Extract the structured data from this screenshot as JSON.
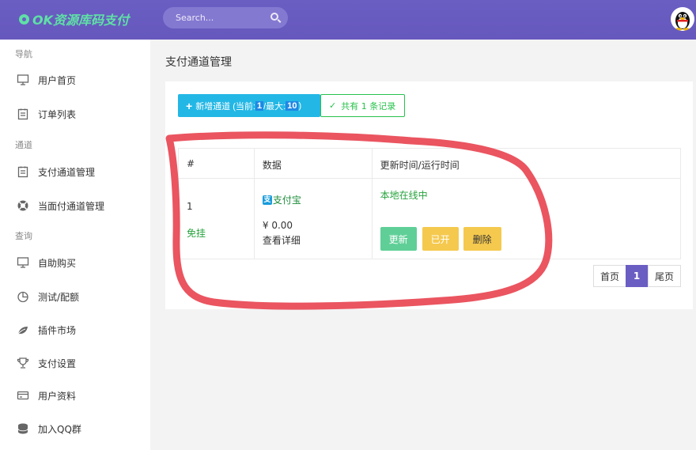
{
  "header": {
    "brand": "OK资源库码支付",
    "search_placeholder": "Search..."
  },
  "sidebar": {
    "sections": [
      "导航",
      "通道",
      "查询"
    ],
    "items": [
      {
        "label": "用户首页",
        "icon": "monitor-icon"
      },
      {
        "label": "订单列表",
        "icon": "clipboard-icon"
      },
      {
        "label": "支付通道管理",
        "icon": "clipboard-icon"
      },
      {
        "label": "当面付通道管理",
        "icon": "lifebuoy-icon"
      },
      {
        "label": "自助购买",
        "icon": "monitor-icon"
      },
      {
        "label": "测试/配额",
        "icon": "pie-chart-icon"
      },
      {
        "label": "插件市场",
        "icon": "leaf-icon"
      },
      {
        "label": "支付设置",
        "icon": "trophy-icon"
      },
      {
        "label": "用户资料",
        "icon": "credit-card-icon"
      },
      {
        "label": "加入QQ群",
        "icon": "database-icon"
      }
    ]
  },
  "main": {
    "title": "支付通道管理",
    "add_button": {
      "prefix": "新增通道 (当前: ",
      "current": "1",
      "middle": "/最大: ",
      "max": "10",
      "suffix": ")"
    },
    "record_count": "共有 1 条记录",
    "table": {
      "headers": [
        "#",
        "数据",
        "更新时间/运行时间"
      ],
      "rows": [
        {
          "id": "1",
          "status": "免挂",
          "channel": "支付宝",
          "amount": "¥ 0.00",
          "detail_link": "查看详细",
          "runtime": "本地在线中",
          "actions": {
            "update": "更新",
            "open": "已开",
            "delete": "删除"
          }
        }
      ]
    },
    "pagination": {
      "first": "首页",
      "current": "1",
      "last": "尾页"
    }
  },
  "colors": {
    "header_bg": "#6a5ec3",
    "brand_green": "#5fe0a6",
    "primary_blue": "#23b7e5",
    "success_green": "#27c24c",
    "warning_yellow": "#f5c94e",
    "annotation_red": "#e8434f"
  }
}
